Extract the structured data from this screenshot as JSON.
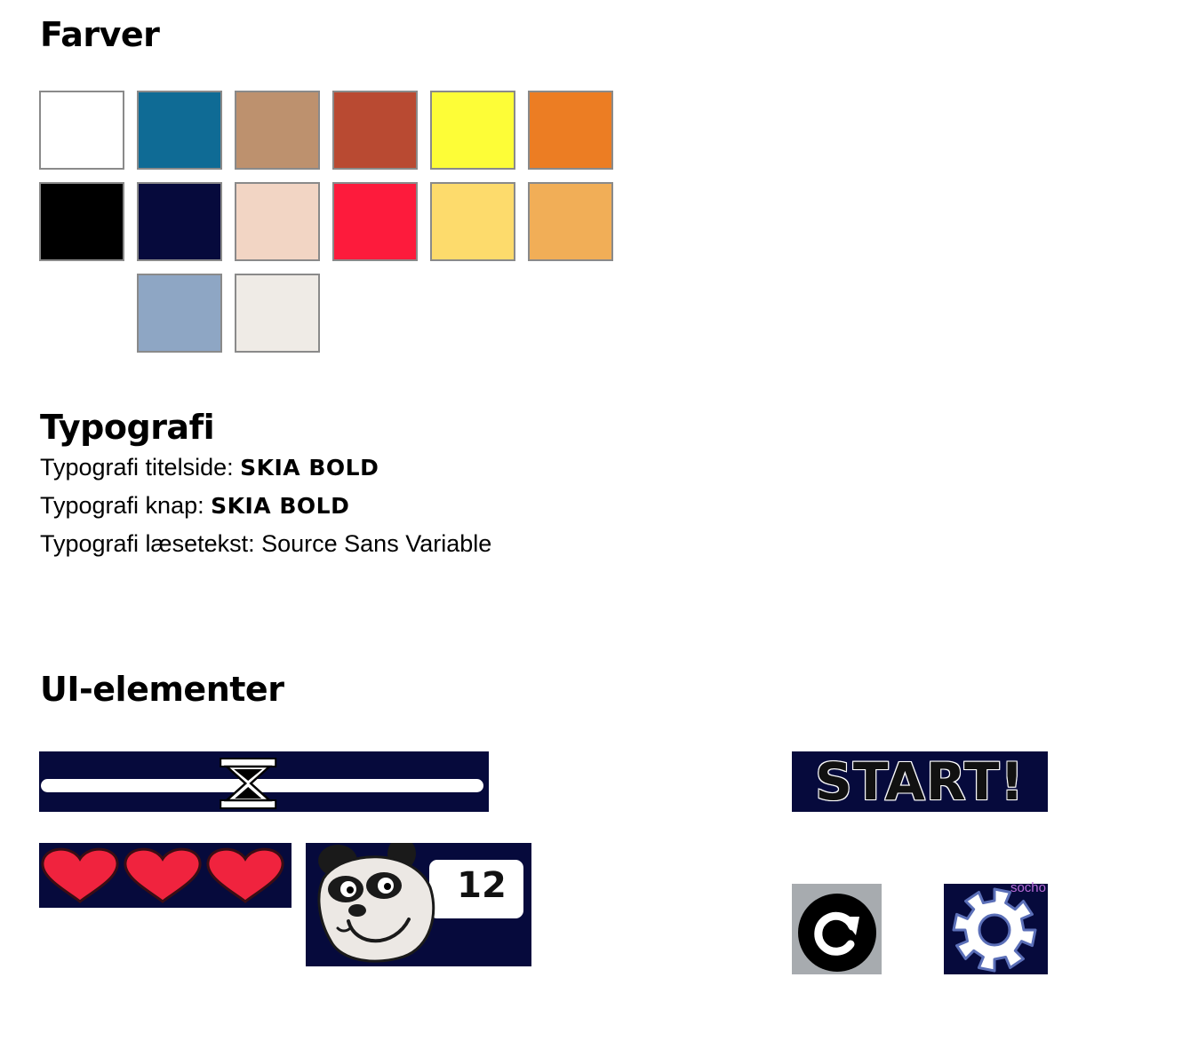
{
  "sections": {
    "colors_title": "Farver",
    "typography_title": "Typografi",
    "ui_title": "UI-elementer"
  },
  "palette": [
    {
      "row": 0,
      "col": 0,
      "hex": "#ffffff"
    },
    {
      "row": 0,
      "col": 1,
      "hex": "#0f6b95"
    },
    {
      "row": 0,
      "col": 2,
      "hex": "#bd916e"
    },
    {
      "row": 0,
      "col": 3,
      "hex": "#b94a32"
    },
    {
      "row": 0,
      "col": 4,
      "hex": "#fdfd37"
    },
    {
      "row": 0,
      "col": 5,
      "hex": "#ec7d23"
    },
    {
      "row": 1,
      "col": 0,
      "hex": "#000000"
    },
    {
      "row": 1,
      "col": 1,
      "hex": "#060a3c"
    },
    {
      "row": 1,
      "col": 2,
      "hex": "#f2d5c4"
    },
    {
      "row": 1,
      "col": 3,
      "hex": "#fd1b3c"
    },
    {
      "row": 1,
      "col": 4,
      "hex": "#fddb6c"
    },
    {
      "row": 1,
      "col": 5,
      "hex": "#f1ae57"
    },
    {
      "row": 2,
      "col": 1,
      "hex": "#8ea6c4"
    },
    {
      "row": 2,
      "col": 2,
      "hex": "#efebe6"
    }
  ],
  "typography": {
    "title_label": "Typografi titelside: ",
    "title_font": "SKIA BOLD",
    "button_label": "Typografi knap: ",
    "button_font": "SKIA BOLD",
    "body_label": "Typografi læsetekst: ",
    "body_font": "Source Sans Variable"
  },
  "ui_elements": {
    "timer": {
      "icon": "hourglass-icon",
      "progress": 0.47
    },
    "lives": {
      "count": 3,
      "icon": "heart-icon",
      "color": "#f0233e"
    },
    "score": {
      "value": "12",
      "icon": "panda-face-icon"
    },
    "start_label": "START!",
    "restart": {
      "icon": "restart-icon",
      "background": "#a7abaf"
    },
    "settings": {
      "icon": "gear-icon",
      "tag": "socho"
    },
    "panel_color": "#060a3c"
  }
}
